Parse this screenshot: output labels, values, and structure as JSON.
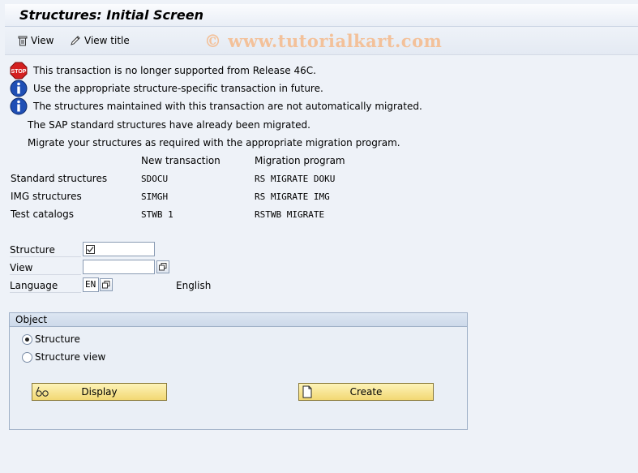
{
  "window": {
    "title": "Structures: Initial Screen"
  },
  "toolbar": {
    "view_label": "View",
    "view_title_label": "View title"
  },
  "watermark": "© www.tutorialkart.com",
  "messages": [
    {
      "type": "stop",
      "text": "This transaction is  no longer supported from Release 46C."
    },
    {
      "type": "info",
      "text": "Use the appropriate structure-specific transaction in future."
    },
    {
      "type": "info",
      "text": "The structures maintained with this transaction are not automatically migrated."
    }
  ],
  "notes": [
    "The SAP standard structures have already been migrated.",
    "Migrate your structures as required with the appropriate migration program."
  ],
  "mapping": {
    "headers": [
      "New transaction",
      "Migration program"
    ],
    "rows": [
      {
        "label": "Standard structures",
        "transaction": "SDOCU",
        "program": "RS MIGRATE DOKU"
      },
      {
        "label": "IMG structures",
        "transaction": "SIMGH",
        "program": "RS MIGRATE IMG"
      },
      {
        "label": "Test catalogs",
        "transaction": "STWB 1",
        "program": "RSTWB MIGRATE"
      }
    ]
  },
  "form": {
    "structure": {
      "label": "Structure",
      "value": ""
    },
    "view": {
      "label": "View",
      "value": ""
    },
    "language": {
      "label": "Language",
      "value": "EN",
      "description": "English"
    }
  },
  "object": {
    "title": "Object",
    "options": [
      {
        "label": "Structure",
        "selected": true
      },
      {
        "label": "Structure view",
        "selected": false
      }
    ],
    "display_button": "Display",
    "create_button": "Create"
  },
  "colors": {
    "accent_button": "#f2d873",
    "info_icon": "#1f4fb5",
    "stop_icon": "#d42020"
  }
}
